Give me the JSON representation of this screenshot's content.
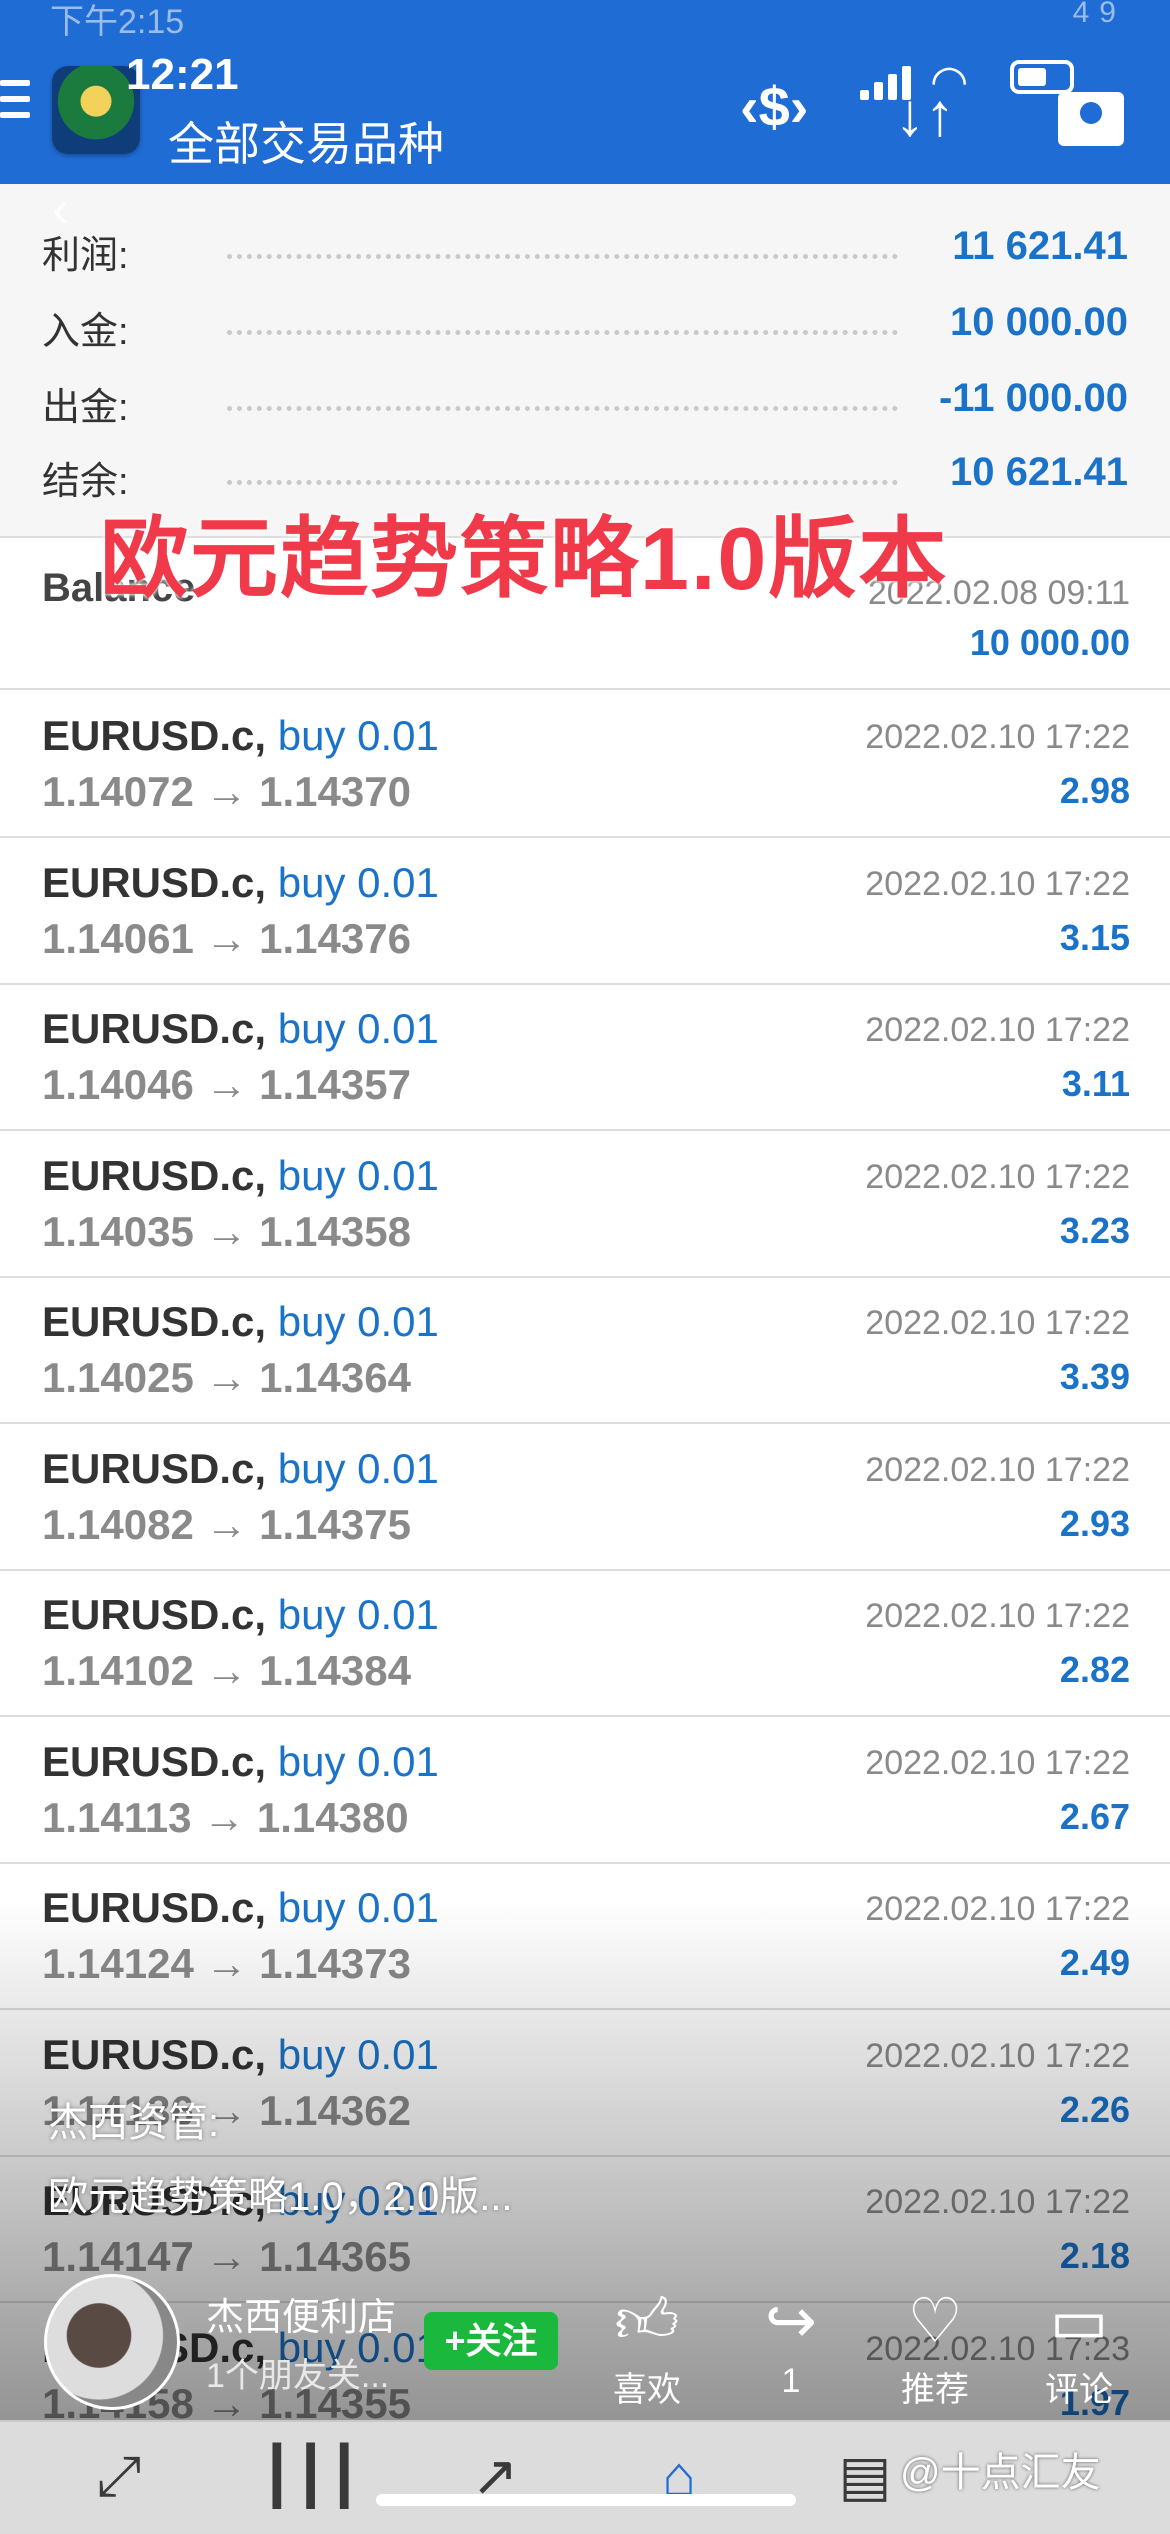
{
  "status": {
    "clock": "12:21",
    "ghost_time": "下午2:15",
    "ghost_battery": "49"
  },
  "header": {
    "title": "全部交易品种"
  },
  "summary": [
    {
      "label": "利润:",
      "value": "11 621.41"
    },
    {
      "label": "入金:",
      "value": "10 000.00"
    },
    {
      "label": "出金:",
      "value": "-11 000.00"
    },
    {
      "label": "结余:",
      "value": "10 621.41"
    }
  ],
  "overlay_title": "欧元趋势策略1.0版本",
  "balance": {
    "label": "Balance",
    "time": "2022.02.08 09:11",
    "amount": "10 000.00"
  },
  "trades": [
    {
      "symbol": "EURUSD.c,",
      "side": "buy 0.01",
      "prices": "1.14072 → 1.14370",
      "time": "2022.02.10 17:22",
      "profit": "2.98"
    },
    {
      "symbol": "EURUSD.c,",
      "side": "buy 0.01",
      "prices": "1.14061 → 1.14376",
      "time": "2022.02.10 17:22",
      "profit": "3.15"
    },
    {
      "symbol": "EURUSD.c,",
      "side": "buy 0.01",
      "prices": "1.14046 → 1.14357",
      "time": "2022.02.10 17:22",
      "profit": "3.11"
    },
    {
      "symbol": "EURUSD.c,",
      "side": "buy 0.01",
      "prices": "1.14035 → 1.14358",
      "time": "2022.02.10 17:22",
      "profit": "3.23"
    },
    {
      "symbol": "EURUSD.c,",
      "side": "buy 0.01",
      "prices": "1.14025 → 1.14364",
      "time": "2022.02.10 17:22",
      "profit": "3.39"
    },
    {
      "symbol": "EURUSD.c,",
      "side": "buy 0.01",
      "prices": "1.14082 → 1.14375",
      "time": "2022.02.10 17:22",
      "profit": "2.93"
    },
    {
      "symbol": "EURUSD.c,",
      "side": "buy 0.01",
      "prices": "1.14102 → 1.14384",
      "time": "2022.02.10 17:22",
      "profit": "2.82"
    },
    {
      "symbol": "EURUSD.c,",
      "side": "buy 0.01",
      "prices": "1.14113 → 1.14380",
      "time": "2022.02.10 17:22",
      "profit": "2.67"
    },
    {
      "symbol": "EURUSD.c,",
      "side": "buy 0.01",
      "prices": "1.14124 → 1.14373",
      "time": "2022.02.10 17:22",
      "profit": "2.49"
    },
    {
      "symbol": "EURUSD.c,",
      "side": "buy 0.01",
      "prices": "1.14136 → 1.14362",
      "time": "2022.02.10 17:22",
      "profit": "2.26"
    },
    {
      "symbol": "EURUSD.c,",
      "side": "buy 0.01",
      "prices": "1.14147 → 1.14365",
      "time": "2022.02.10 17:22",
      "profit": "2.18"
    },
    {
      "symbol": "EURUSD.c,",
      "side": "buy 0.01",
      "prices": "1.14158 → 1.14355",
      "time": "2022.02.10 17:23",
      "profit": "1.97"
    }
  ],
  "post": {
    "author": "杰西资管:",
    "caption": "欧元趋势策略1.0，2.0版...",
    "shop_name": "杰西便利店",
    "friends": "1个朋友关...",
    "follow_label": "+关注",
    "actions": [
      {
        "label": "喜欢",
        "icon": "thumbs-up-icon"
      },
      {
        "label": "1",
        "icon": "share-icon"
      },
      {
        "label": "推荐",
        "icon": "heart-icon"
      },
      {
        "label": "评论",
        "icon": "comment-icon"
      }
    ]
  },
  "watermark": "@十点汇友",
  "colors": {
    "header_blue": "#1f6cd4",
    "value_blue": "#1a73c9",
    "overlay_red": "#f03a4a",
    "follow_green": "#1ab83c"
  }
}
